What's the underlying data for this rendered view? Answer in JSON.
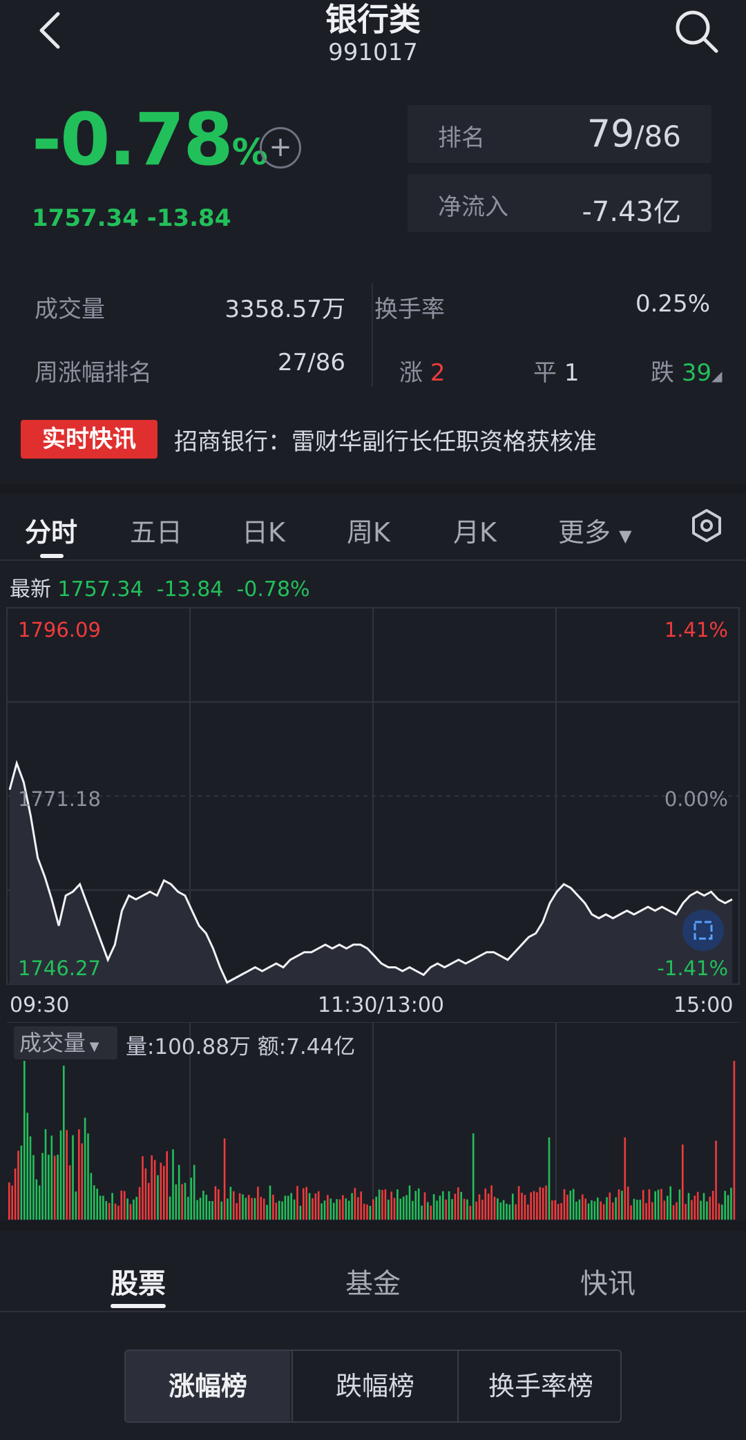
{
  "header": {
    "title": "银行类",
    "code": "991017"
  },
  "quote": {
    "change_pct": "-0.78",
    "pct_unit": "%",
    "price": "1757.34",
    "change": "-13.84"
  },
  "rank": {
    "label": "排名",
    "value": "79",
    "total": "/86"
  },
  "net_inflow": {
    "label": "净流入",
    "value": "-7.43亿"
  },
  "stats": {
    "volume_label": "成交量",
    "volume_value": "3358.57万",
    "turnover_label": "换手率",
    "turnover_value": "0.25%",
    "weekly_rank_label": "周涨幅排名",
    "weekly_rank_value": "27/86",
    "up_label": "涨",
    "up_count": "2",
    "flat_label": "平",
    "flat_count": "1",
    "down_label": "跌",
    "down_count": "39"
  },
  "news": {
    "tag": "实时快讯",
    "text": "招商银行：雷财华副行长任职资格获核准"
  },
  "chart_tabs": [
    "分时",
    "五日",
    "日K",
    "周K",
    "月K",
    "更多"
  ],
  "latest_row": {
    "label": "最新",
    "price": "1757.34",
    "change": "-13.84",
    "pct": "-0.78%"
  },
  "chart_data": {
    "type": "line",
    "y_labels": {
      "high": "1796.09",
      "mid": "1771.18",
      "low": "1746.27"
    },
    "pct_labels": {
      "high": "1.41%",
      "mid": "0.00%",
      "low": "-1.41%"
    },
    "ylim": [
      1746.27,
      1796.09
    ],
    "x_labels": [
      "09:30",
      "11:30/13:00",
      "15:00"
    ],
    "series": [
      {
        "values": [
          1772.0,
          1775.5,
          1773.0,
          1768.5,
          1763.0,
          1760.5,
          1757.5,
          1754.0,
          1758.0,
          1758.5,
          1759.5,
          1757.0,
          1754.5,
          1752.0,
          1749.5,
          1751.5,
          1756.0,
          1758.0,
          1757.5,
          1758.0,
          1758.5,
          1758.0,
          1760.0,
          1759.5,
          1758.5,
          1758.0,
          1756.0,
          1754.0,
          1753.0,
          1751.0,
          1748.5,
          1746.5,
          1747.0,
          1747.5,
          1748.0,
          1748.5,
          1748.0,
          1748.5,
          1749.0,
          1748.5,
          1749.5,
          1750.0,
          1750.5,
          1750.5,
          1751.0,
          1751.5,
          1751.0,
          1751.5,
          1751.0,
          1751.5,
          1751.5,
          1751.0,
          1750.0,
          1749.0,
          1748.5,
          1748.5,
          1748.0,
          1748.5,
          1748.0,
          1747.5,
          1748.5,
          1749.0,
          1748.5,
          1749.0,
          1749.5,
          1749.0,
          1749.5,
          1750.0,
          1750.5,
          1750.5,
          1750.0,
          1749.5,
          1750.5,
          1751.5,
          1752.5,
          1753.0,
          1754.5,
          1757.0,
          1758.5,
          1759.5,
          1759.0,
          1758.0,
          1757.0,
          1755.5,
          1755.0,
          1755.5,
          1755.0,
          1755.5,
          1756.0,
          1755.5,
          1756.0,
          1756.5,
          1756.0,
          1756.5,
          1756.0,
          1755.5,
          1757.0,
          1758.0,
          1758.5,
          1758.0,
          1758.5,
          1757.5,
          1757.0,
          1757.5
        ]
      }
    ],
    "volume": {
      "label": "成交量",
      "info": "量:100.88万 额:7.44亿",
      "colors": {
        "up": "#ef3b3b",
        "down": "#22c05a"
      }
    }
  },
  "bottom_tabs": [
    "股票",
    "基金",
    "快讯"
  ],
  "segment": [
    "涨幅榜",
    "跌幅榜",
    "换手率榜"
  ],
  "colors": {
    "bg": "#1c1e26",
    "green": "#22c05a",
    "red": "#ef3b3b",
    "tag_red": "#e02f2f"
  }
}
